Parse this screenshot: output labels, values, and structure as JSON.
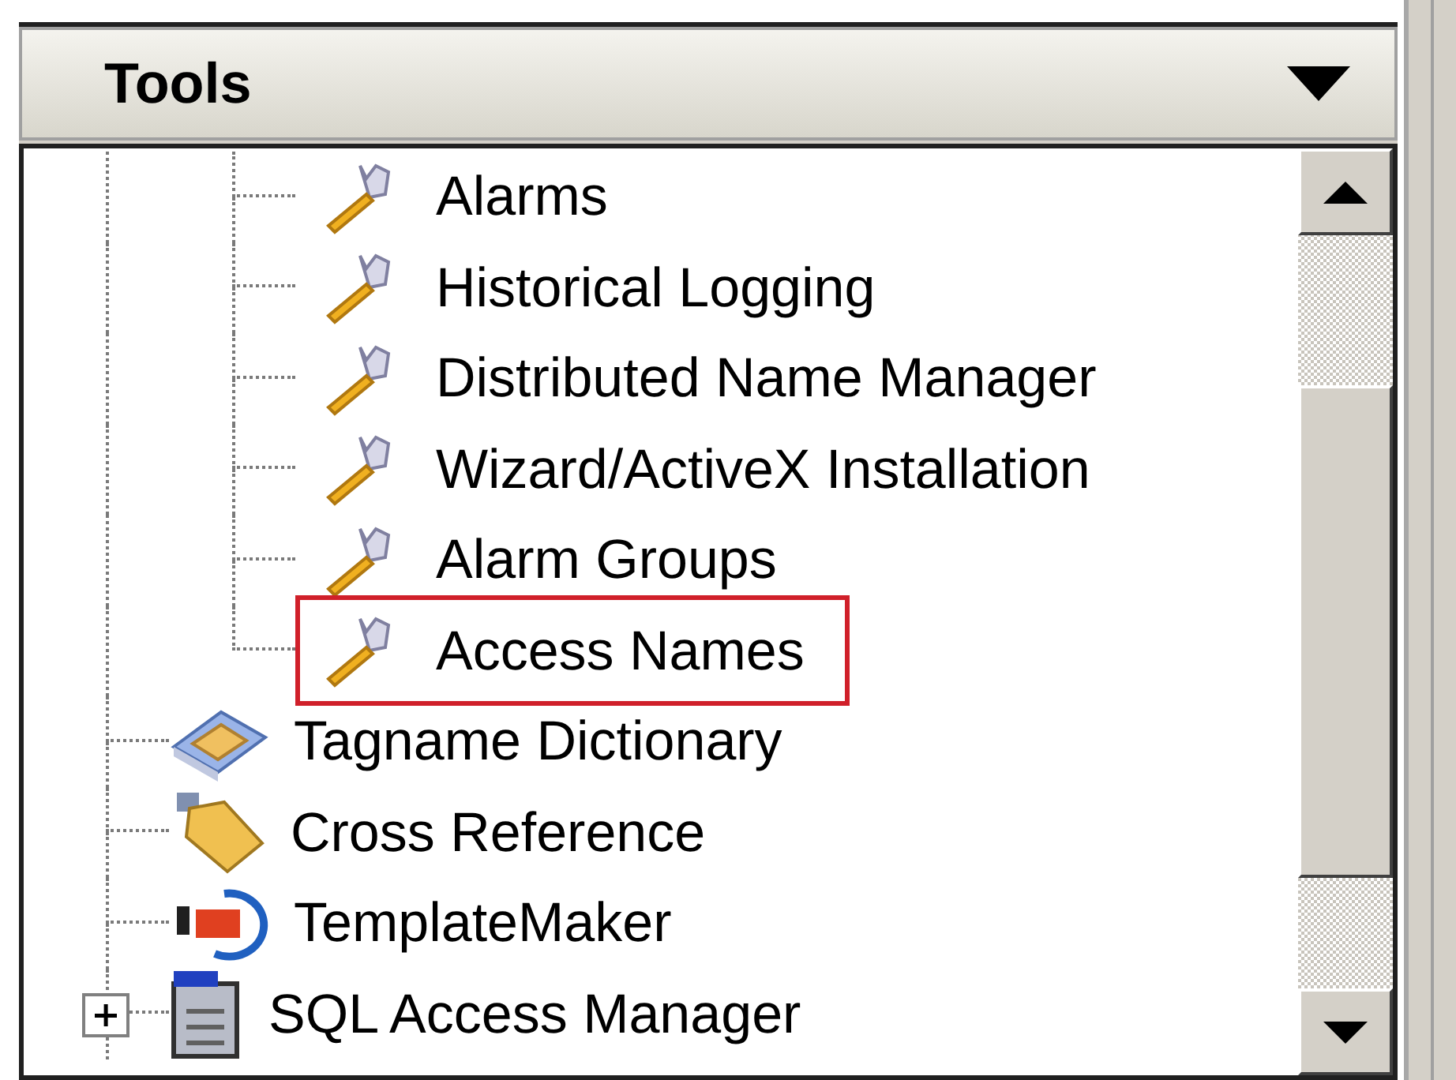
{
  "panel": {
    "title": "Tools"
  },
  "tree": {
    "items": [
      {
        "children": [
          {
            "label": "Alarms",
            "kind": "tool",
            "highlighted": false
          },
          {
            "label": "Historical Logging",
            "kind": "tool",
            "highlighted": false
          },
          {
            "label": "Distributed Name Manager",
            "kind": "tool",
            "highlighted": false
          },
          {
            "label": "Wizard/ActiveX Installation",
            "kind": "tool",
            "highlighted": false
          },
          {
            "label": "Alarm Groups",
            "kind": "tool",
            "highlighted": false
          },
          {
            "label": "Access Names",
            "kind": "tool",
            "highlighted": true
          }
        ]
      },
      {
        "label": "Tagname Dictionary",
        "kind": "dictionary",
        "highlighted": false
      },
      {
        "label": "Cross Reference",
        "kind": "reference",
        "highlighted": false
      },
      {
        "label": "TemplateMaker",
        "kind": "template",
        "highlighted": false
      },
      {
        "label": "SQL Access Manager",
        "kind": "server",
        "highlighted": false,
        "expanded": false
      }
    ]
  }
}
